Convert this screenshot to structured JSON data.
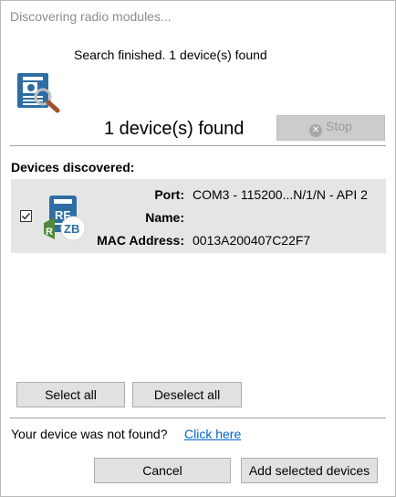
{
  "window": {
    "title": "Discovering radio modules..."
  },
  "search": {
    "status": "Search finished. 1 device(s) found",
    "count_text": "1 device(s) found",
    "stop_label": "Stop"
  },
  "devices": {
    "heading": "Devices discovered:",
    "items": [
      {
        "checked": true,
        "port_label": "Port:",
        "port_value": "COM3 - 115200...N/1/N - API 2",
        "name_label": "Name:",
        "name_value": "",
        "mac_label": "MAC Address:",
        "mac_value": "0013A200407C22F7",
        "icon": "zigbee-module-icon"
      }
    ]
  },
  "actions": {
    "select_all": "Select all",
    "deselect_all": "Deselect all"
  },
  "footer": {
    "not_found": "Your device was not found?",
    "link": "Click here",
    "cancel": "Cancel",
    "add": "Add selected devices"
  },
  "colors": {
    "link": "#0066cc",
    "row_bg": "#e5e5e5",
    "button_bg": "#e1e1e1",
    "module_blue": "#2e6da4"
  }
}
